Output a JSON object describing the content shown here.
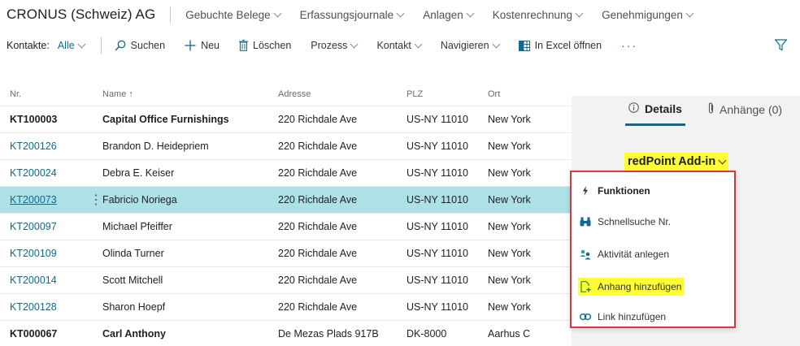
{
  "app": {
    "company": "CRONUS (Schweiz) AG",
    "nav": [
      "Gebuchte Belege",
      "Erfassungsjournale",
      "Anlagen",
      "Kostenrechnung",
      "Genehmigungen"
    ]
  },
  "actionbar": {
    "label": "Kontakte:",
    "filter": "Alle",
    "search": "Suchen",
    "new": "Neu",
    "delete": "Löschen",
    "process": "Prozess",
    "contact": "Kontakt",
    "navigate": "Navigieren",
    "excel": "In Excel öffnen",
    "more": "···"
  },
  "table": {
    "headers": {
      "nr": "Nr.",
      "name": "Name ↑",
      "address": "Adresse",
      "plz": "PLZ",
      "ort": "Ort"
    },
    "rows": [
      {
        "nr": "KT100003",
        "name": "Capital Office Furnishings",
        "address": "220 Richdale Ave",
        "plz": "US-NY 11010",
        "ort": "New York"
      },
      {
        "nr": "KT200126",
        "name": "Brandon D. Heidepriem",
        "address": "220 Richdale Ave",
        "plz": "US-NY 11010",
        "ort": "New York"
      },
      {
        "nr": "KT200024",
        "name": "Debra E. Keiser",
        "address": "220 Richdale Ave",
        "plz": "US-NY 11010",
        "ort": "New York"
      },
      {
        "nr": "KT200073",
        "name": "Fabricio Noriega",
        "address": "220 Richdale Ave",
        "plz": "US-NY 11010",
        "ort": "New York"
      },
      {
        "nr": "KT200097",
        "name": "Michael Pfeiffer",
        "address": "220 Richdale Ave",
        "plz": "US-NY 11010",
        "ort": "New York"
      },
      {
        "nr": "KT200109",
        "name": "Olinda Turner",
        "address": "220 Richdale Ave",
        "plz": "US-NY 11010",
        "ort": "New York"
      },
      {
        "nr": "KT200014",
        "name": "Scott Mitchell",
        "address": "220 Richdale Ave",
        "plz": "US-NY 11010",
        "ort": "New York"
      },
      {
        "nr": "KT200128",
        "name": "Sharon Hoepf",
        "address": "220 Richdale Ave",
        "plz": "US-NY 11010",
        "ort": "New York"
      },
      {
        "nr": "KT000067",
        "name": "Carl Anthony",
        "address": "De Mezas Plads 917B",
        "plz": "DK-8000",
        "ort": "Aarhus C"
      }
    ],
    "dots": "⋮"
  },
  "factbox": {
    "details_tab": "Details",
    "attachments_tab": "Anhänge (0)",
    "addin_label": "redPoint Add-in"
  },
  "menu": {
    "items": [
      {
        "label": "Funktionen",
        "icon": "bolt-icon"
      },
      {
        "label": "Schnellsuche Nr.",
        "icon": "binoculars-icon"
      },
      {
        "label": "Aktivität anlegen",
        "icon": "people-icon"
      },
      {
        "label": "Anhang hinzufügen",
        "icon": "add-file-icon"
      },
      {
        "label": "Link hinzufügen",
        "icon": "link-icon"
      }
    ]
  },
  "colors": {
    "accent": "#0f6a8b",
    "selected_row": "#aee1e5",
    "highlight": "#ffff33",
    "menu_border": "#d9363e"
  }
}
